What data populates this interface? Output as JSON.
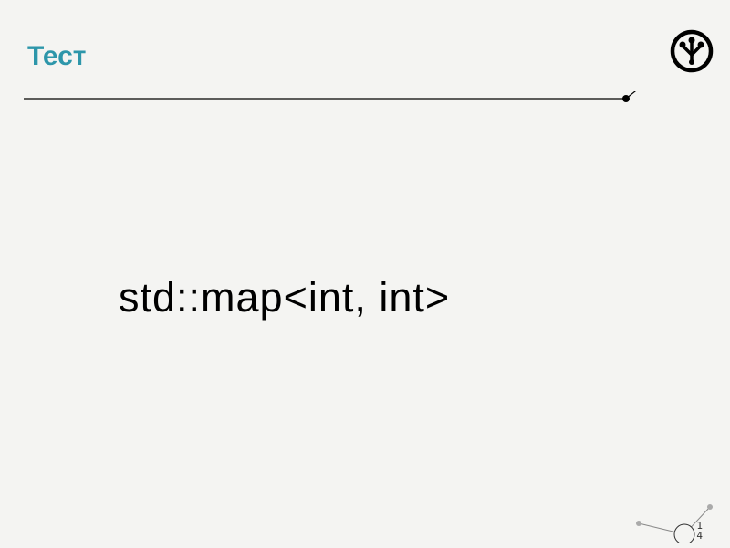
{
  "slide": {
    "title": "Тест",
    "content": "std::map<int, int>",
    "page_number_line1": "1",
    "page_number_line2": "4"
  }
}
